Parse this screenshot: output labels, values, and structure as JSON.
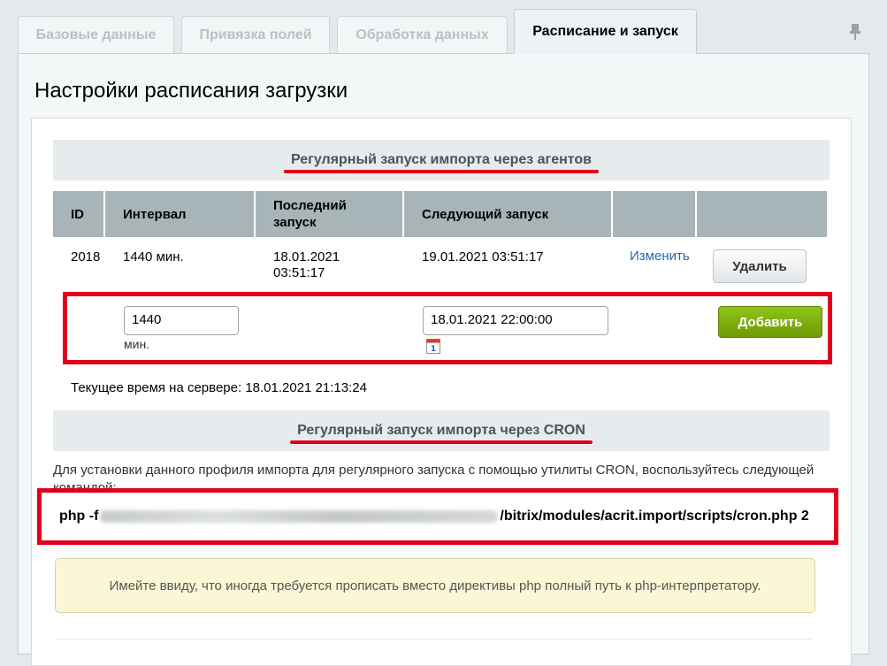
{
  "tabs": [
    {
      "label": "Базовые данные"
    },
    {
      "label": "Привязка полей"
    },
    {
      "label": "Обработка данных"
    },
    {
      "label": "Расписание и запуск"
    }
  ],
  "page_title": "Настройки расписания загрузки",
  "agents_section": {
    "title": "Регулярный запуск импорта через агентов"
  },
  "table": {
    "headers": [
      "ID",
      "Интервал",
      "Последний запуск",
      "Следующий запуск",
      "",
      ""
    ],
    "row": {
      "id": "2018",
      "interval": "1440 мин.",
      "last_run": "18.01.2021 03:51:17",
      "next_run": "19.01.2021 03:51:17",
      "edit_label": "Изменить",
      "delete_label": "Удалить"
    }
  },
  "new_agent": {
    "interval_value": "1440",
    "interval_unit": "мин.",
    "next_run_value": "18.01.2021 22:00:00",
    "add_label": "Добавить"
  },
  "server_time": "Текущее время на сервере: 18.01.2021 21:13:24",
  "cron_section": {
    "title": "Регулярный запуск импорта через CRON",
    "description": "Для установки данного профиля импорта для регулярного запуска с помощью утилиты CRON, воспользуйтесь следующей командой:",
    "command_prefix": "php -f",
    "command_suffix": "/bitrix/modules/acrit.import/scripts/cron.php 2"
  },
  "note": "Имейте ввиду, что иногда требуется прописать вместо директивы php полный путь к php-интерпретатору.",
  "colors": {
    "highlight": "#e0001b",
    "add_button": "#7fae0c",
    "header_bg": "#a8b5b8"
  }
}
